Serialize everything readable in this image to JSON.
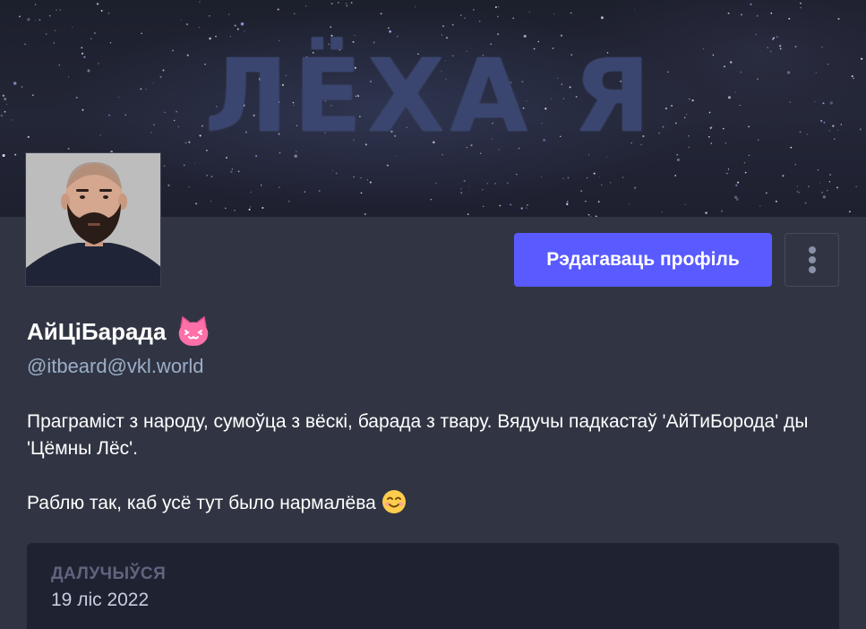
{
  "banner": {
    "title": "ЛЁХА Я"
  },
  "profile": {
    "display_name": "АйЦіБарада",
    "handle": "@itbeard@vkl.world",
    "name_emoji_icon": "pink-cat-emoji-icon",
    "bio": [
      "Праграміст з народу, сумоўца з вёскі, барада з твару. Вядучы падкастаў 'АйТиБорода' ды 'Цёмны Лёс'.",
      "Раблю так, каб усё тут было нармалёва"
    ],
    "bio_emoji_icon": "smiling-face-icon"
  },
  "actions": {
    "edit_profile_label": "Рэдагаваць профіль",
    "more_icon": "vertical-ellipsis-icon"
  },
  "joined": {
    "label": "ДАЛУЧЫЎСЯ",
    "date": "19 ліс 2022"
  },
  "colors": {
    "accent": "#595aff",
    "background": "#313543",
    "card": "#1f2230",
    "handle": "#9baec8"
  }
}
